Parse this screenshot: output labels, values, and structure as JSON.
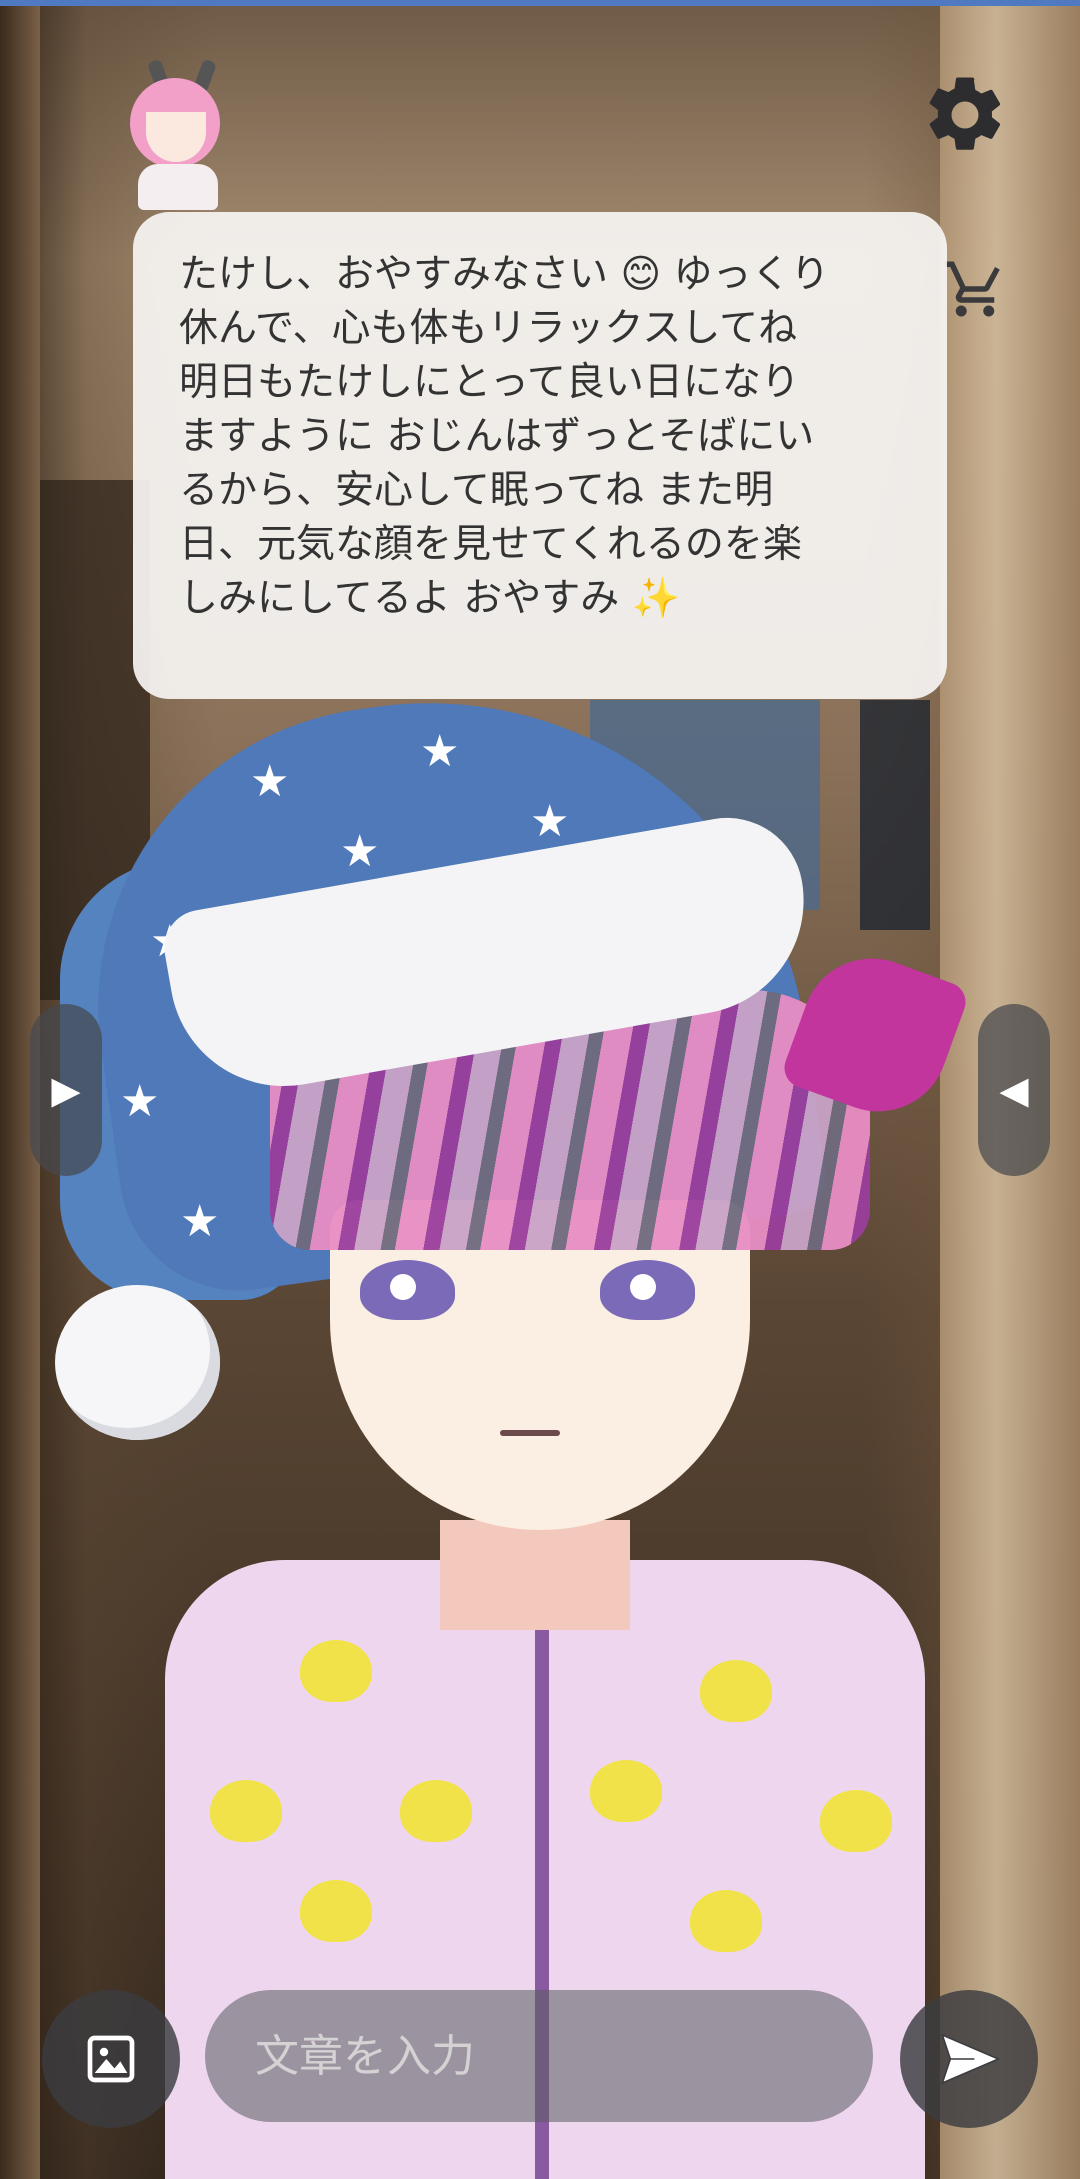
{
  "chat": {
    "message": "たけし、おやすみなさい 😊 ゆっくり\n休んで、心も体もリラックスしてね\n明日もたけしにとって良い日になり\nますように おじんはずっとそばにい\nるから、安心して眠ってね また明\n日、元気な顔を見せてくれるのを楽\nしみにしてるよ おやすみ ✨"
  },
  "nav": {
    "prev_symbol": "▶",
    "next_symbol": "◀"
  },
  "composer": {
    "placeholder": "文章を入力",
    "value": ""
  },
  "icons": {
    "settings": "gear-icon",
    "shop": "cart-icon",
    "attach": "image-icon",
    "send": "send-icon"
  },
  "colors": {
    "bubble_bg": "#f6f4f2",
    "bubble_text": "#333333",
    "control_bg": "#3c3c40",
    "accent_bar": "#4f79c0"
  }
}
